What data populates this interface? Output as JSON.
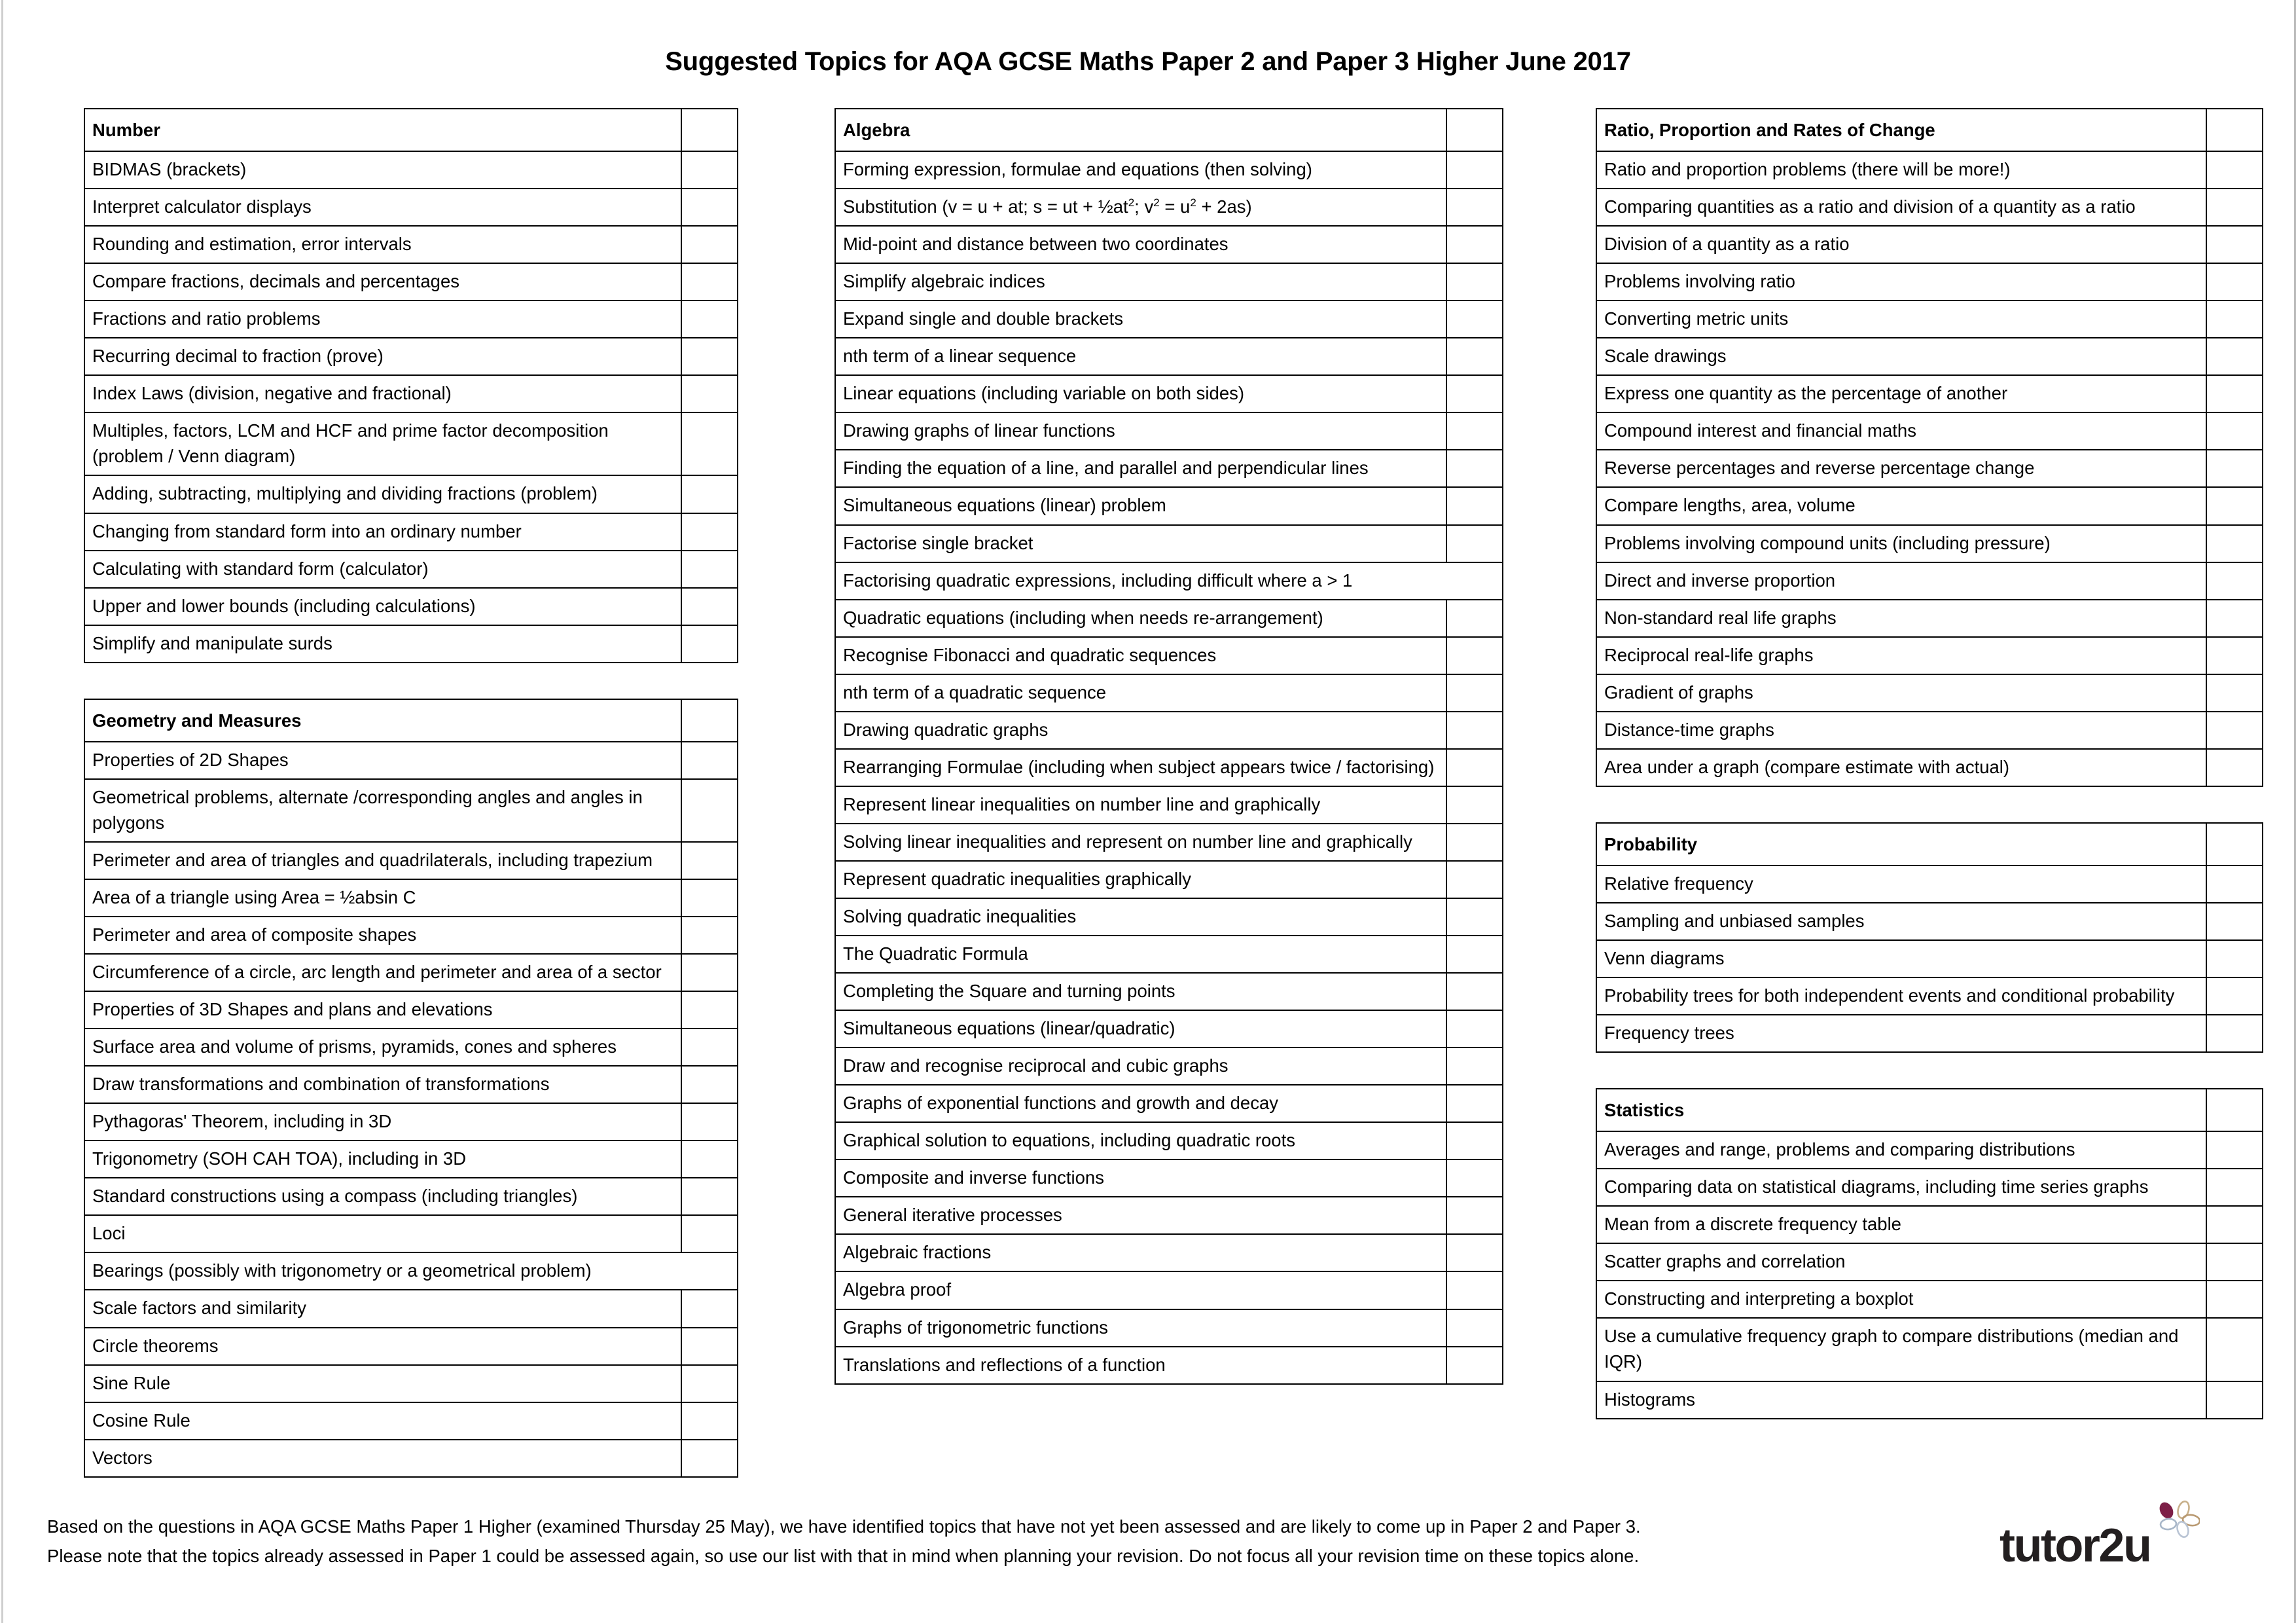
{
  "document": {
    "title": "Suggested Topics for AQA GCSE Maths Paper 2 and Paper 3 Higher June 2017"
  },
  "columns": [
    {
      "name": "column-left",
      "tables": [
        {
          "heading": "Number",
          "rows": [
            "BIDMAS (brackets)",
            "Interpret calculator displays",
            "Rounding and estimation, error intervals",
            "Compare fractions, decimals and percentages",
            "Fractions and ratio problems",
            "Recurring decimal to fraction (prove)",
            "Index Laws (division, negative and fractional)",
            "Multiples, factors, LCM and HCF and prime factor decomposition (problem / Venn diagram)",
            "Adding, subtracting, multiplying and dividing fractions (problem)",
            "Changing from standard form into an ordinary number",
            "Calculating with standard form (calculator)",
            "Upper and lower bounds (including calculations)",
            "Simplify and manipulate surds"
          ]
        },
        {
          "heading": "Geometry and Measures",
          "rows": [
            "Properties of 2D Shapes",
            "Geometrical problems, alternate /corresponding angles and angles in polygons",
            "Perimeter and area of triangles and quadrilaterals, including trapezium",
            "Area of a triangle using Area = ½absin C",
            "Perimeter and area of composite shapes",
            "Circumference of a circle, arc length and perimeter and area of a sector",
            "Properties of 3D Shapes and plans and elevations",
            "Surface area and volume of prisms, pyramids, cones and spheres",
            "Draw transformations and combination of transformations",
            "Pythagoras' Theorem, including in 3D",
            "Trigonometry (SOH CAH TOA), including in 3D",
            "Standard constructions using a compass (including triangles)",
            "Loci",
            "Bearings (possibly with trigonometry or a geometrical problem)",
            "Scale factors and similarity",
            "Circle theorems",
            "Sine Rule",
            "Cosine Rule",
            "Vectors"
          ]
        }
      ]
    },
    {
      "name": "column-middle",
      "tables": [
        {
          "heading": "Algebra",
          "rows": [
            "Forming expression, formulae and equations (then solving)",
            "Substitution (v = u + at; s = ut + ½at<sup>2</sup>; v<sup>2</sup> = u<sup>2</sup> + 2as)",
            "Mid-point and distance between two coordinates",
            "Simplify algebraic indices",
            "Expand single and double brackets",
            "nth term of a linear sequence",
            "Linear equations (including variable on both sides)",
            "Drawing graphs of linear functions",
            "Finding the equation of a line, and parallel and perpendicular lines",
            "Simultaneous equations (linear) problem",
            "Factorise single bracket",
            "Factorising quadratic expressions, including difficult where a > 1",
            "Quadratic equations (including when needs re-arrangement)",
            "Recognise Fibonacci and quadratic sequences",
            "nth term of a quadratic sequence",
            "Drawing quadratic graphs",
            "Rearranging Formulae (including when subject appears twice / factorising)",
            "Represent linear inequalities on number line and graphically",
            "Solving linear inequalities and represent on number line and graphically",
            "Represent quadratic inequalities graphically",
            "Solving quadratic inequalities",
            "The Quadratic Formula",
            "Completing the Square and turning points",
            "Simultaneous equations (linear/quadratic)",
            "Draw and recognise reciprocal and cubic graphs",
            "Graphs of exponential functions and growth and decay",
            "Graphical solution to equations, including quadratic roots",
            "Composite and inverse functions",
            "General iterative processes",
            "Algebraic fractions",
            "Algebra proof",
            "Graphs of trigonometric functions",
            "Translations and reflections of a function"
          ]
        }
      ]
    },
    {
      "name": "column-right",
      "tables": [
        {
          "heading": "Ratio, Proportion and Rates of Change",
          "rows": [
            "Ratio and proportion problems (there will be more!)",
            "Comparing quantities as a ratio and division of a quantity as a ratio",
            "Division of a quantity as a ratio",
            "Problems involving ratio",
            "Converting metric units",
            "Scale drawings",
            "Express one quantity as the percentage of another",
            "Compound interest and financial maths",
            "Reverse percentages and reverse percentage change",
            "Compare lengths, area, volume",
            "Problems involving compound units (including pressure)",
            "Direct and inverse proportion",
            "Non-standard real life graphs",
            "Reciprocal real-life graphs",
            "Gradient of graphs",
            "Distance-time graphs",
            "Area under a graph (compare estimate with actual)"
          ]
        },
        {
          "heading": "Probability",
          "rows": [
            "Relative frequency",
            "Sampling and unbiased samples",
            "Venn diagrams",
            "Probability trees for both independent events and conditional probability",
            "Frequency trees"
          ]
        },
        {
          "heading": "Statistics",
          "rows": [
            "Averages and range, problems and comparing distributions",
            "Comparing data on statistical diagrams, including time series graphs",
            "Mean from a discrete frequency table",
            "Scatter graphs and correlation",
            "Constructing and interpreting a boxplot",
            "Use a cumulative frequency graph to compare distributions (median and IQR)",
            "Histograms"
          ]
        }
      ]
    }
  ],
  "footer": {
    "line1": "Based on the questions in AQA GCSE Maths Paper 1 Higher (examined Thursday 25 May), we have identified topics that have not yet been assessed and are likely to come up in Paper 2 and Paper 3.",
    "line2": "Please note that the topics already assessed in Paper 1 could be assessed again, so use our list with that in mind when planning your revision.  Do not focus all your revision time on these topics alone."
  },
  "logo": {
    "wordmark": "tutor2u",
    "petal_colors": [
      "#7d1f47",
      "#b9c4d4",
      "#c8b08a",
      "#a8b7c9",
      "#b99a72"
    ]
  }
}
